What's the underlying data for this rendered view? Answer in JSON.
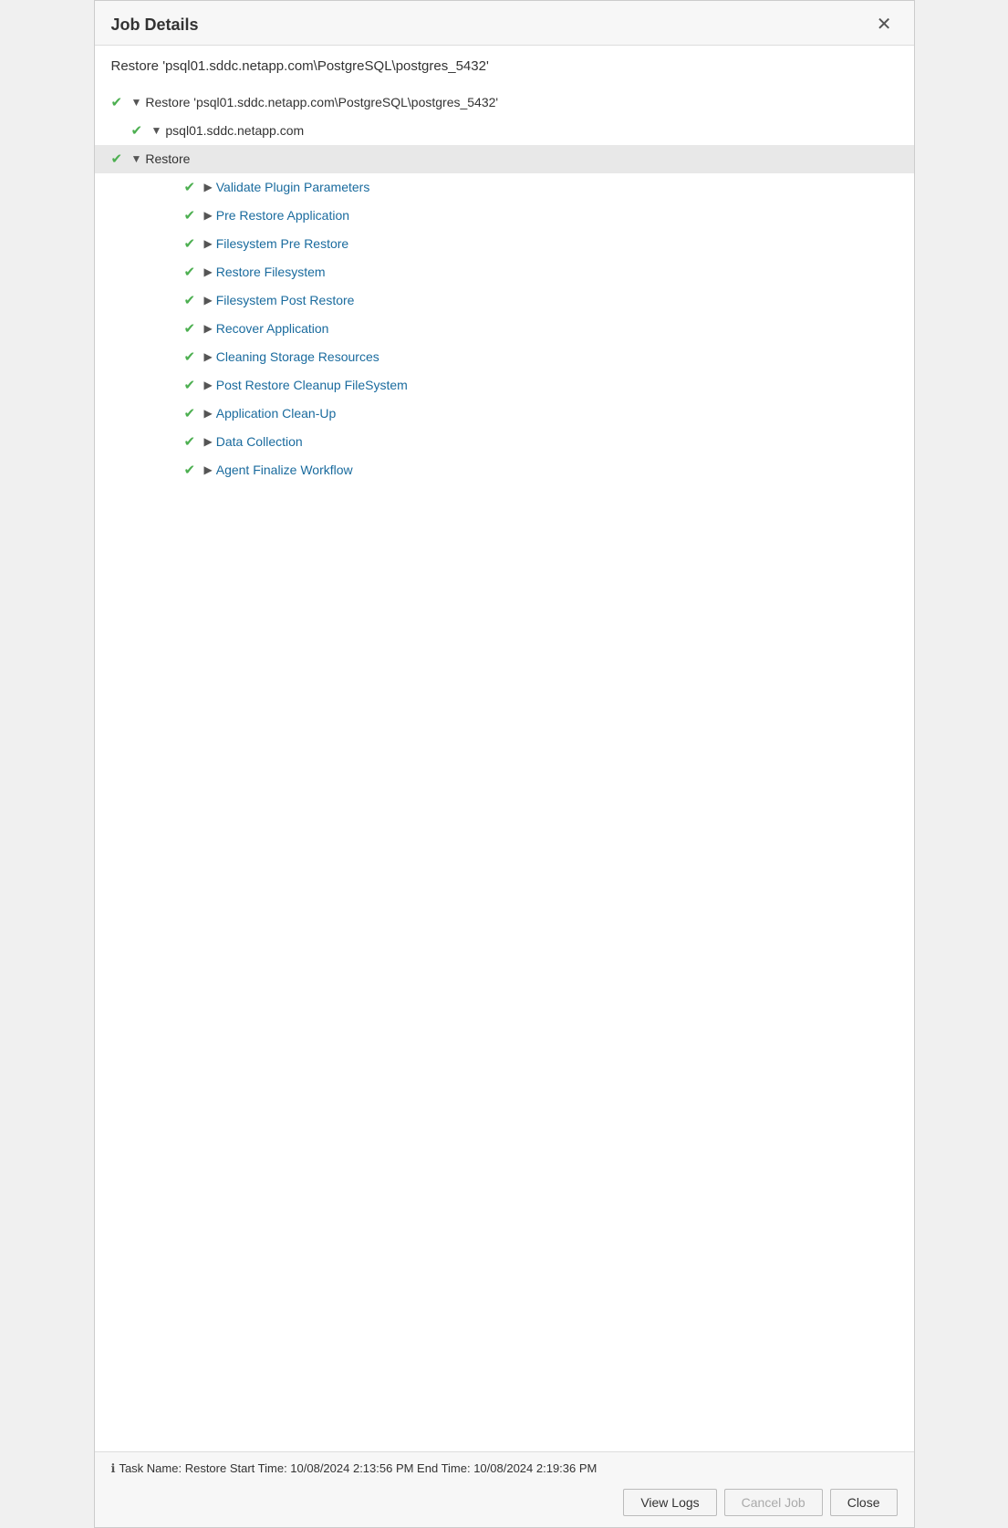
{
  "dialog": {
    "title": "Job Details",
    "subtitle": "Restore 'psql01.sddc.netapp.com\\PostgreSQL\\postgres_5432'"
  },
  "tree": {
    "level1": {
      "label": "Restore 'psql01.sddc.netapp.com\\PostgreSQL\\postgres_5432'",
      "status": "check"
    },
    "level2": {
      "label": "psql01.sddc.netapp.com",
      "status": "check"
    },
    "level3": {
      "label": "Restore",
      "status": "check"
    },
    "items": [
      {
        "label": "Validate Plugin Parameters",
        "status": "check"
      },
      {
        "label": "Pre Restore Application",
        "status": "check"
      },
      {
        "label": "Filesystem Pre Restore",
        "status": "check"
      },
      {
        "label": "Restore Filesystem",
        "status": "check"
      },
      {
        "label": "Filesystem Post Restore",
        "status": "check"
      },
      {
        "label": "Recover Application",
        "status": "check"
      },
      {
        "label": "Cleaning Storage Resources",
        "status": "check"
      },
      {
        "label": "Post Restore Cleanup FileSystem",
        "status": "check"
      },
      {
        "label": "Application Clean-Up",
        "status": "check"
      },
      {
        "label": "Data Collection",
        "status": "check"
      },
      {
        "label": "Agent Finalize Workflow",
        "status": "check"
      }
    ]
  },
  "footer": {
    "info": "Task Name: Restore  Start Time: 10/08/2024 2:13:56 PM  End Time: 10/08/2024 2:19:36 PM",
    "buttons": {
      "view_logs": "View Logs",
      "cancel_job": "Cancel Job",
      "close": "Close"
    }
  },
  "icons": {
    "check": "✔",
    "arrow_right": "▶",
    "arrow_down": "▼",
    "close": "✕",
    "info": "ℹ"
  }
}
